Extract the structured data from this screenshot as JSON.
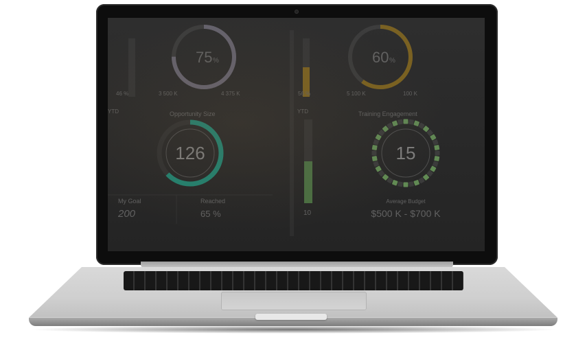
{
  "dashboard": {
    "top_left": {
      "gauge_value": "75",
      "gauge_unit": "%",
      "bar_label": "46 %",
      "stat1_value": "3 500 K",
      "stat2_value": "4 375 K"
    },
    "top_right": {
      "gauge_value": "60",
      "gauge_unit": "%",
      "bar_label": "56 %",
      "stat1_value": "5 100 K",
      "stat2_value": "100 K"
    },
    "mid_left": {
      "ytd_label": "YTD",
      "title": "Opportunity Size",
      "gauge_value": "126",
      "my_goal_label": "My Goal",
      "my_goal_value": "200",
      "reached_label": "Reached",
      "reached_value": "65 %"
    },
    "mid_right": {
      "ytd_label": "YTD",
      "bar_value": "10",
      "title": "Training Engagement",
      "gauge_value": "15",
      "avg_label": "Average Budget",
      "avg_value": "$500 K - $700 K"
    }
  },
  "colors": {
    "teal_accent": "#1f8f7a",
    "gold_accent": "#b8860b",
    "green_bar": "#6a9a5a"
  },
  "gauges": {
    "top_left_fill": 0.75,
    "top_right_fill": 0.6,
    "opportunity_fill": 0.63,
    "ytd_bar_fill": 0.5
  }
}
